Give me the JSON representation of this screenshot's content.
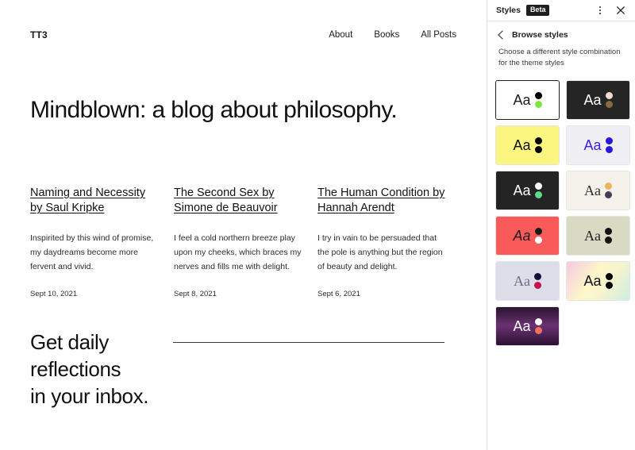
{
  "site": {
    "logo": "TT3",
    "nav": [
      {
        "label": "About"
      },
      {
        "label": "Books"
      },
      {
        "label": "All Posts"
      }
    ],
    "hero_title": "Mindblown: a blog about philosophy.",
    "posts": [
      {
        "title": "Naming and Necessity by Saul Kripke",
        "excerpt": "Inspirited by this wind of promise, my daydreams become more fervent and vivid.",
        "date": "Sept 10, 2021"
      },
      {
        "title": "The Second Sex by Simone de Beauvoir",
        "excerpt": "I feel a cold northern breeze play upon my cheeks, which braces my nerves and fills me with delight.",
        "date": "Sept 8, 2021"
      },
      {
        "title": "The Human Condition by Hannah Arendt",
        "excerpt": "I try in vain to be persuaded that the pole is anything but the region of beauty and delight.",
        "date": "Sept 6, 2021"
      }
    ],
    "newsletter": {
      "title": "Get daily\nreflections\nin your inbox."
    }
  },
  "sidebar": {
    "title": "Styles",
    "badge": "Beta",
    "more_actions_label": "Options",
    "close_label": "Close",
    "breadcrumb_back_label": "Browse styles",
    "description": "Choose a different style combination for the theme styles",
    "swatch_sample_text": "Aa",
    "swatches": [
      {
        "name": "default-light",
        "bg": "#ffffff",
        "text_color": "#1e1e1e",
        "font": "sans",
        "italic": false,
        "dot1": "#000000",
        "dot2": "#7ee63f",
        "selected": true
      },
      {
        "name": "dark-tan",
        "bg": "#252525",
        "text_color": "#ffffff",
        "font": "sans",
        "italic": false,
        "dot1": "#f0ddd0",
        "dot2": "#8a6a42",
        "selected": false
      },
      {
        "name": "yellow",
        "bg": "#fbf67f",
        "text_color": "#111111",
        "font": "sans",
        "italic": false,
        "dot1": "#000000",
        "dot2": "#000000",
        "selected": false
      },
      {
        "name": "pale-blue-violet",
        "bg": "#f0f0f4",
        "text_color": "#3b1ce8",
        "font": "sans",
        "italic": false,
        "dot1": "#2a14e0",
        "dot2": "#2a14e0",
        "selected": false
      },
      {
        "name": "dark-green",
        "bg": "#242424",
        "text_color": "#ffffff",
        "font": "sans",
        "italic": false,
        "dot1": "#ffffff",
        "dot2": "#5fd98c",
        "selected": false
      },
      {
        "name": "cream-serif",
        "bg": "#f5f2ec",
        "text_color": "#2b2b2b",
        "font": "serif",
        "italic": false,
        "dot1": "#eeb45e",
        "dot2": "#4b3b56",
        "selected": false
      },
      {
        "name": "coral-italic",
        "bg": "#fb5a5a",
        "text_color": "#1e1e1e",
        "font": "sans",
        "italic": true,
        "dot1": "#1a1a1a",
        "dot2": "#ffffff",
        "selected": false
      },
      {
        "name": "sage-serif",
        "bg": "#d9dac3",
        "text_color": "#1e1e1e",
        "font": "serif",
        "italic": false,
        "dot1": "#121212",
        "dot2": "#121212",
        "selected": false
      },
      {
        "name": "lavender-serif",
        "bg": "#dedeeb",
        "text_color": "#6b6b86",
        "font": "serif",
        "italic": false,
        "dot1": "#12123c",
        "dot2": "#c6134c",
        "selected": false
      },
      {
        "name": "pastel-gradient",
        "bg": "linear-gradient(125deg, #f6c9e4 0%, #fdf6c8 42%, #f7f4cf 62%, #cdeede 100%)",
        "text_color": "#111111",
        "font": "sans",
        "italic": false,
        "dot1": "#000000",
        "dot2": "#000000",
        "selected": false
      },
      {
        "name": "dark-purple-gradient",
        "bg": "linear-gradient(180deg, #2a1430 0%, #6b3172 48%, #2b1233 100%)",
        "text_color": "#ffffff",
        "font": "sans",
        "italic": false,
        "dot1": "#ffffff",
        "dot2": "#f2705e",
        "selected": false
      }
    ]
  }
}
